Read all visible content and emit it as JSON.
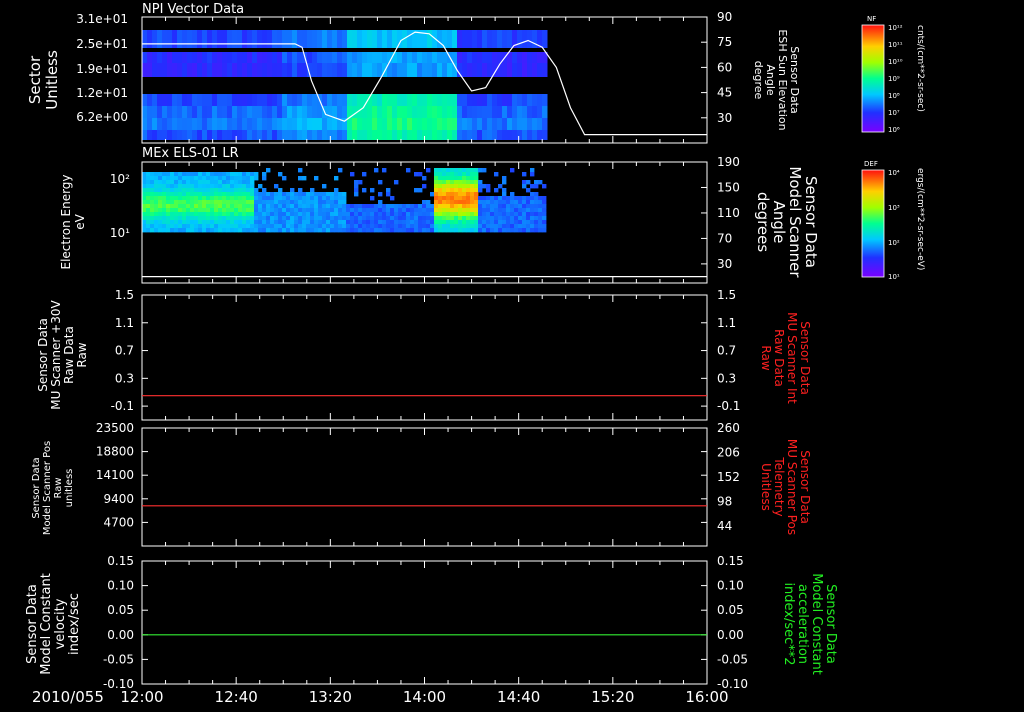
{
  "colors": {
    "background": "#000000",
    "frame": "#ffffff",
    "red_trace": "#ff3030",
    "green_trace": "#33ee33",
    "red_label": "#ff2020",
    "green_label": "#22ee22"
  },
  "time_axis": {
    "date_label": "2010/055",
    "start": "12:00",
    "end": "16:00",
    "tick_labels": [
      "12:00",
      "12:40",
      "13:20",
      "14:00",
      "14:40",
      "15:20",
      "16:00"
    ],
    "data_end": "14:50"
  },
  "colorbars": [
    {
      "title": "NF",
      "unit": "cnts/(cm**2-sr-sec)",
      "tick_labels": [
        "10¹²",
        "10¹¹",
        "10¹⁰",
        "10⁹",
        "10⁸",
        "10⁷",
        "10⁶"
      ]
    },
    {
      "title": "DEF",
      "unit": "ergs/(cm**2-sr-sec-eV)",
      "tick_labels": [
        "10⁴",
        "10³",
        "10²",
        "10¹"
      ]
    }
  ],
  "chart_data": [
    {
      "type": "heatmap",
      "title": "NPI Vector Data",
      "ylabel": [
        "Sector",
        "Unitless"
      ],
      "y_tick_labels": [
        "3.1e+01",
        "2.5e+01",
        "1.9e+01",
        "1.2e+01",
        "6.2e+00"
      ],
      "right_ylabel": [
        "Sensor Data",
        "ESH Sun Elevation",
        "Angle",
        "degree"
      ],
      "right_ylim": [
        15,
        90
      ],
      "right_y_ticks": [
        30,
        45,
        60,
        75,
        90
      ],
      "line_series": {
        "x": [
          "12:00",
          "13:05",
          "13:08",
          "13:12",
          "13:18",
          "13:26",
          "13:34",
          "13:42",
          "13:50",
          "13:56",
          "14:02",
          "14:08",
          "14:14",
          "14:20",
          "14:26",
          "14:32",
          "14:38",
          "14:44",
          "14:50",
          "14:56",
          "15:02",
          "15:08",
          "16:00"
        ],
        "y": [
          74,
          74,
          72,
          52,
          32,
          28,
          36,
          55,
          76,
          81,
          80,
          73,
          58,
          46,
          48,
          62,
          73,
          76,
          72,
          60,
          36,
          20,
          20
        ]
      }
    },
    {
      "type": "heatmap",
      "title": "MEx ELS-01 LR",
      "ylabel": [
        "Electron Energy",
        "eV"
      ],
      "y_tick_labels": [
        "10²",
        "10¹"
      ],
      "right_ylabel": [
        "Sensor Data",
        "Model Scanner",
        "Angle",
        "degrees"
      ],
      "right_ylim": [
        0,
        190
      ],
      "right_y_ticks": [
        30,
        70,
        110,
        150,
        190
      ],
      "line_series": {
        "x": [
          "12:00",
          "16:00"
        ],
        "y": [
          10,
          10
        ]
      }
    },
    {
      "type": "line",
      "ylabel": [
        "Sensor Data",
        "MU Scanner +30V",
        "Raw Data",
        "Raw"
      ],
      "ylim": [
        -0.3,
        1.5
      ],
      "y_ticks": [
        "1.5",
        "1.1",
        "0.7",
        "0.3",
        "-0.1"
      ],
      "right_ylabel": [
        "Sensor Data",
        "MU Scanner Int",
        "Raw Data",
        "Raw"
      ],
      "right_y_ticks": [
        "1.5",
        "1.1",
        "0.7",
        "0.3",
        "-0.1"
      ],
      "series": [
        {
          "x": [
            "12:00",
            "16:00"
          ],
          "values": [
            0.05,
            0.05
          ]
        }
      ]
    },
    {
      "type": "line",
      "ylabel": [
        "Sensor Data",
        "Model Scanner Pos",
        "Raw",
        "unitless"
      ],
      "ylim": [
        0,
        23500
      ],
      "y_ticks": [
        "23500",
        "18800",
        "14100",
        "9400",
        "4700"
      ],
      "right_ylabel": [
        "Sensor Data",
        "MU Scanner Pos",
        "Telemetry",
        "Unitless"
      ],
      "right_y_ticks": [
        "260",
        "206",
        "152",
        "98",
        "44"
      ],
      "series": [
        {
          "x": [
            "12:00",
            "16:00"
          ],
          "values": [
            8000,
            8000
          ]
        }
      ]
    },
    {
      "type": "line",
      "ylabel": [
        "Sensor Data",
        "Model Constant",
        "velocity",
        "index/sec"
      ],
      "ylim": [
        -0.1,
        0.15
      ],
      "y_ticks": [
        "0.15",
        "0.10",
        "0.05",
        "0.00",
        "-0.05",
        "-0.10"
      ],
      "right_ylabel": [
        "Sensor Data",
        "Model Constant",
        "acceleration",
        "index/sec**2"
      ],
      "right_y_ticks": [
        "0.15",
        "0.10",
        "0.05",
        "0.00",
        "-0.05",
        "-0.10"
      ],
      "series": [
        {
          "x": [
            "12:00",
            "16:00"
          ],
          "values": [
            0.0,
            0.0
          ]
        }
      ]
    }
  ]
}
